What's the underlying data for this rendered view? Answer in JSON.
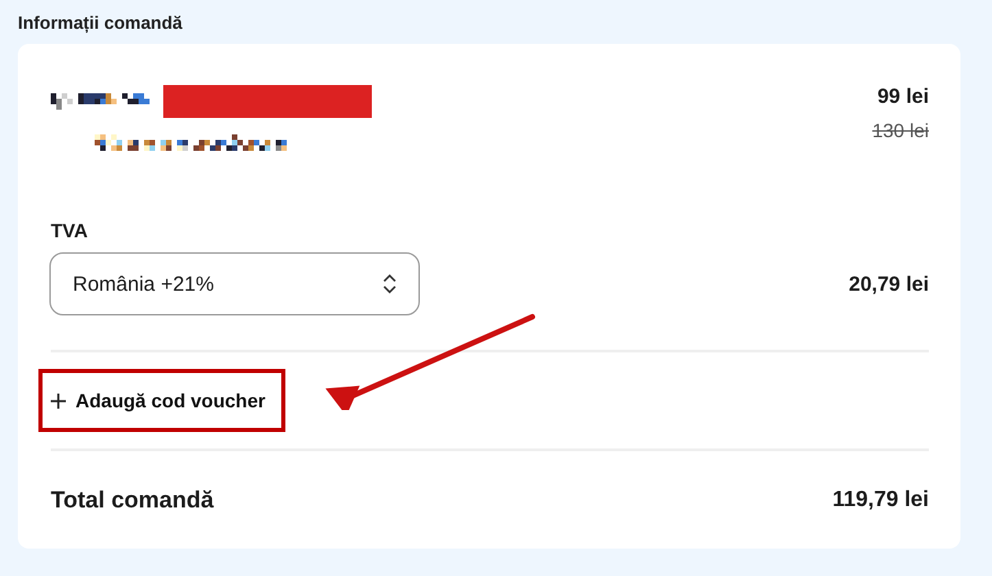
{
  "section_title": "Informații comandă",
  "product": {
    "price": "99 lei",
    "old_price": "130 lei"
  },
  "vat": {
    "label": "TVA",
    "value": "România +21%",
    "amount": "20,79 lei"
  },
  "voucher_link": {
    "label": "Adaugă cod voucher",
    "highlighted": true
  },
  "total": {
    "label": "Total comandă",
    "amount": "119,79 lei"
  }
}
